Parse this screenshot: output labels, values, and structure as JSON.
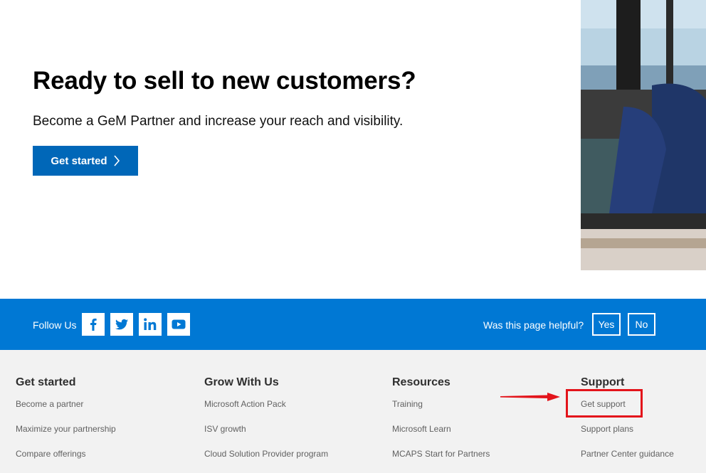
{
  "hero": {
    "title": "Ready to sell to new customers?",
    "subtitle": "Become a GeM Partner and increase your reach and visibility.",
    "cta_label": "Get started"
  },
  "follow_bar": {
    "follow_label": "Follow Us",
    "social": [
      {
        "name": "facebook-icon"
      },
      {
        "name": "twitter-icon"
      },
      {
        "name": "linkedin-icon"
      },
      {
        "name": "youtube-icon"
      }
    ],
    "helpful_label": "Was this page helpful?",
    "yes_label": "Yes",
    "no_label": "No"
  },
  "footer": {
    "columns": [
      {
        "title": "Get started",
        "links": [
          "Become a partner",
          "Maximize your partnership",
          "Compare offerings"
        ]
      },
      {
        "title": "Grow With Us",
        "links": [
          "Microsoft Action Pack",
          "ISV growth",
          "Cloud Solution Provider program"
        ]
      },
      {
        "title": "Resources",
        "links": [
          "Training",
          "Microsoft Learn",
          "MCAPS Start for Partners"
        ]
      },
      {
        "title": "Support",
        "links": [
          "Get support",
          "Support plans",
          "Partner Center guidance"
        ]
      }
    ]
  },
  "colors": {
    "brand_blue": "#0067b8",
    "follow_bar": "#0078d4",
    "footer_bg": "#f2f2f2",
    "annotation_red": "#e3141b"
  }
}
